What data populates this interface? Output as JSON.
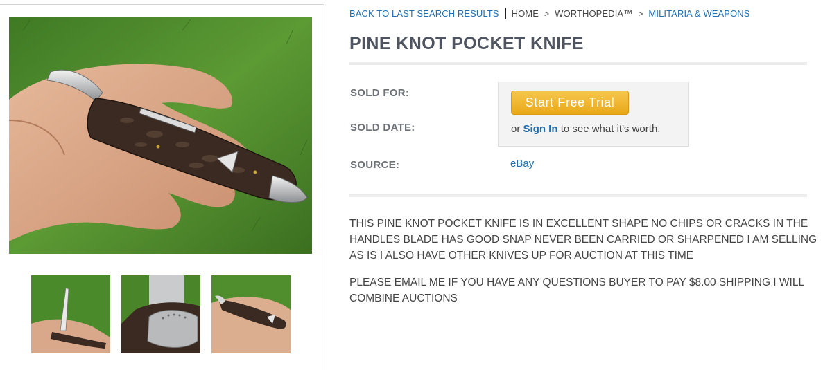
{
  "breadcrumb": {
    "back_label": "BACK TO LAST SEARCH RESULTS",
    "home": "HOME",
    "separator": ">",
    "section": "WORTHOPEDIA™",
    "category": "MILITARIA & WEAPONS"
  },
  "item": {
    "title": "PINE KNOT POCKET KNIFE"
  },
  "fields": {
    "sold_for_label": "SOLD FOR:",
    "sold_date_label": "SOLD DATE:",
    "source_label": "SOURCE:",
    "source_value": "eBay"
  },
  "trial": {
    "button_label": "Start Free Trial",
    "prefix": "or",
    "signin_link": "Sign In",
    "suffix": "to see what it's worth."
  },
  "description": {
    "paragraph_1": "THIS PINE KNOT POCKET KNIFE IS IN EXCELLENT SHAPE NO CHIPS OR CRACKS IN THE HANDLES BLADE HAS GOOD SNAP NEVER BEEN CARRIED OR SHARPENED I AM SELLING AS IS I ALSO HAVE OTHER KNIVES UP FOR AUCTION AT THIS TIME",
    "paragraph_2": "PLEASE EMAIL ME IF YOU HAVE ANY QUESTIONS BUYER TO PAY $8.00 SHIPPING I WILL COMBINE AUCTIONS"
  },
  "gallery": {
    "main_image": "knife-in-hand-photo",
    "thumbnails": [
      "knife-open-blade-photo",
      "knife-blade-stamp-closeup-photo",
      "knife-closed-in-hand-photo"
    ]
  },
  "colors": {
    "link": "#1f6fb2",
    "title": "#4f5560",
    "button": "#f0b530",
    "grass": "#4f8a2c",
    "handle": "#3a2a22"
  }
}
